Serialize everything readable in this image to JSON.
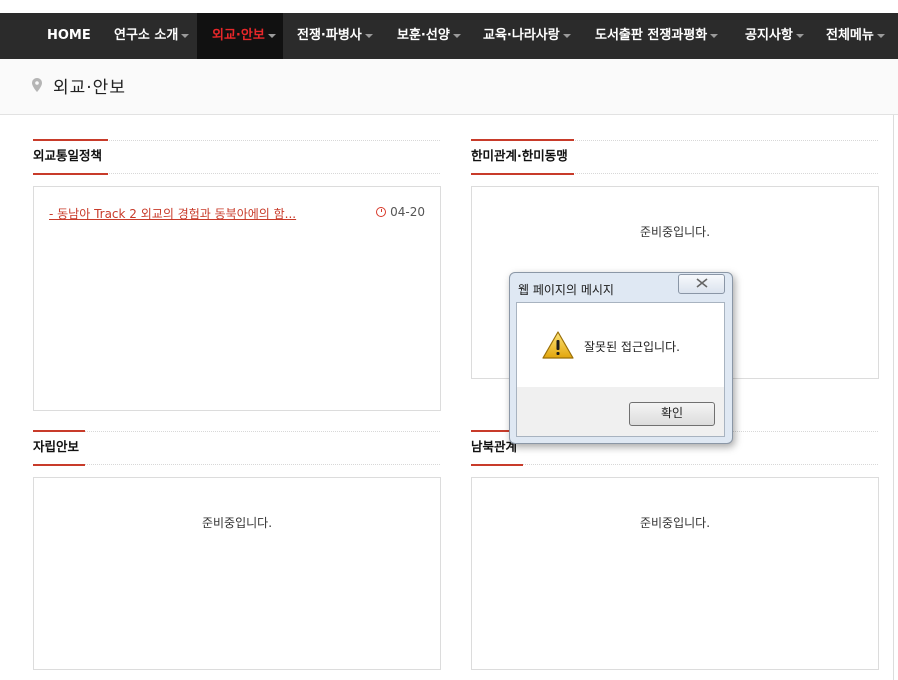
{
  "nav": {
    "items": [
      {
        "label": "HOME",
        "has_caret": false,
        "active": false
      },
      {
        "label": "연구소 소개",
        "has_caret": true,
        "active": false
      },
      {
        "label": "외교·안보",
        "has_caret": true,
        "active": true
      },
      {
        "label": "전쟁·파병사",
        "has_caret": true,
        "active": false
      },
      {
        "label": "보훈·선양",
        "has_caret": true,
        "active": false
      },
      {
        "label": "교육·나라사랑",
        "has_caret": true,
        "active": false
      },
      {
        "label": "도서출판 전쟁과평화",
        "has_caret": true,
        "active": false
      },
      {
        "label": "공지사항",
        "has_caret": true,
        "active": false
      },
      {
        "label": "전체메뉴",
        "has_caret": true,
        "active": false
      }
    ],
    "bg_color": "#2b2b2b",
    "active_color": "#e8272a"
  },
  "page": {
    "title": "외교·안보",
    "icon": "map-pin-icon"
  },
  "sections": {
    "diplomacy": {
      "title": "외교통일정책",
      "items": [
        {
          "title": "- 동남아 Track 2 외교의 경험과 동북아에의 함...",
          "date": "04-20"
        }
      ]
    },
    "alliance": {
      "title": "한미관계·한미동맹",
      "empty_text": "준비중입니다."
    },
    "self_defense": {
      "title": "자립안보",
      "empty_text": "준비중입니다."
    },
    "inter_korea": {
      "title": "남북관계",
      "empty_text": "준비중입니다."
    }
  },
  "dialog": {
    "title": "웹 페이지의 메시지",
    "close_icon": "close-icon",
    "message": "잘못된 접근입니다.",
    "icon": "warning-icon",
    "ok_label": "확인"
  },
  "colors": {
    "accent": "#c83b2a"
  }
}
